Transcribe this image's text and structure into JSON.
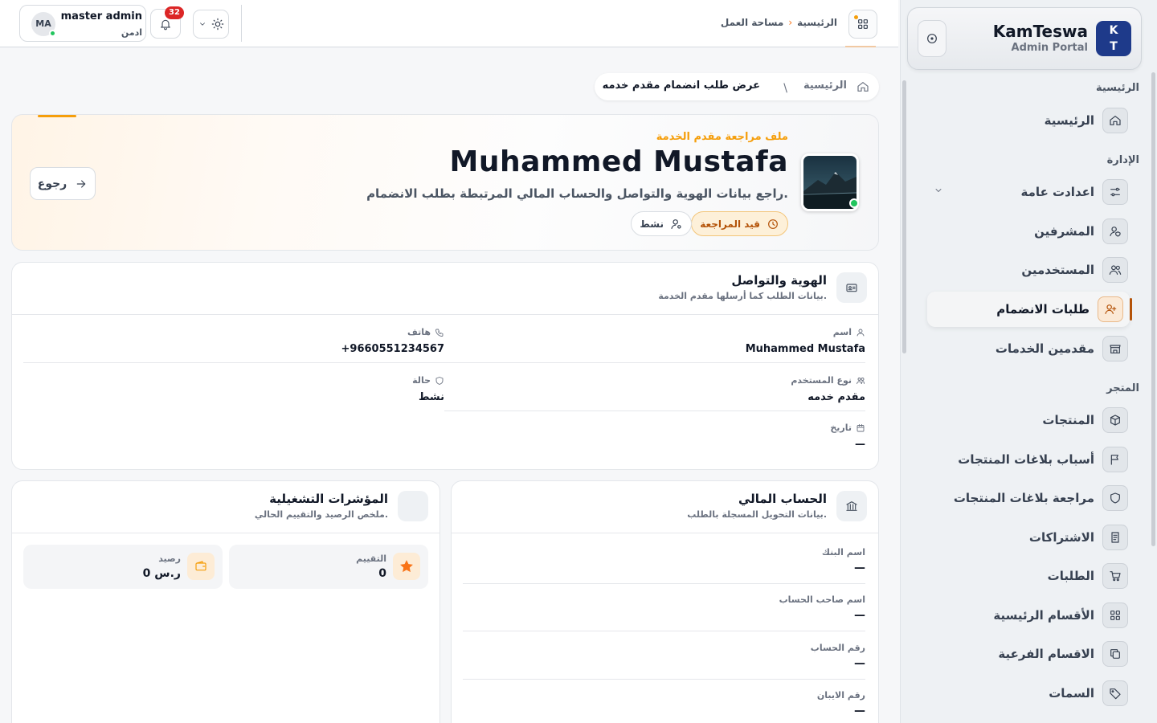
{
  "topbar": {
    "breadcrumb_root": "الرئيسية",
    "breadcrumb_current": "مساحة العمل",
    "notifications_count": "32",
    "user_initials": "MA",
    "user_name": "master admin",
    "user_role": "ادمن"
  },
  "sidebar": {
    "brand_logo_line1": "K",
    "brand_logo_line2": "T",
    "brand_name": "KamTeswa",
    "brand_sub": "Admin Portal",
    "sections": {
      "home": "الرئيسية",
      "admin": "الإدارة",
      "store": "المتجر"
    },
    "items": [
      {
        "label": "الرئيسية",
        "icon": "home-icon"
      },
      {
        "label": "اعدادت عامة",
        "icon": "sliders-icon"
      },
      {
        "label": "المشرفين",
        "icon": "user-shield-icon"
      },
      {
        "label": "المستخدمين",
        "icon": "users-icon"
      },
      {
        "label": "طلبات الانضمام",
        "icon": "user-plus-icon"
      },
      {
        "label": "مقدمين الخدمات",
        "icon": "store-icon"
      },
      {
        "label": "المنتجات",
        "icon": "box-icon"
      },
      {
        "label": "أسباب بلاغات المنتجات",
        "icon": "flag-icon"
      },
      {
        "label": "مراجعة بلاغات المنتجات",
        "icon": "shield-icon"
      },
      {
        "label": "الاشتراكات",
        "icon": "receipt-icon"
      },
      {
        "label": "الطلبات",
        "icon": "cart-icon"
      },
      {
        "label": "الأقسام الرئيسية",
        "icon": "grid-icon"
      },
      {
        "label": "الاقسام الفرعية",
        "icon": "copy-icon"
      },
      {
        "label": "السمات",
        "icon": "tag-icon"
      }
    ]
  },
  "page_breadcrumb": {
    "root": "الرئيسية",
    "separator": "\\",
    "current": "عرض طلب انضمام مقدم خدمه"
  },
  "hero": {
    "eyebrow": "ملف مراجعة مقدم الخدمة",
    "name": "Muhammed Mustafa",
    "description": "راجع بيانات الهوية والتواصل والحساب المالي المرتبطة بطلب الانضمام.",
    "status_review": "قيد المراجعة",
    "status_active": "نشط",
    "back_label": "رجوع"
  },
  "identity": {
    "title": "الهوية والتواصل",
    "subtitle": "بيانات الطلب كما أرسلها مقدم الخدمة.",
    "fields": {
      "name_label": "اسم",
      "name_value": "Muhammed Mustafa",
      "phone_label": "هاتف",
      "phone_value": "+9660551234567",
      "type_label": "نوع المستخدم",
      "type_value": "مقدم خدمه",
      "status_label": "حالة",
      "status_value": "نشط",
      "date_label": "تاريخ",
      "date_value": "—"
    }
  },
  "finance": {
    "title": "الحساب المالي",
    "subtitle": "بيانات التحويل المسجلة بالطلب.",
    "fields": [
      {
        "label": "اسم البنك",
        "value": "—"
      },
      {
        "label": "اسم صاحب الحساب",
        "value": "—"
      },
      {
        "label": "رقم الحساب",
        "value": "—"
      },
      {
        "label": "رقم الايبان",
        "value": "—"
      }
    ]
  },
  "metrics": {
    "title": "المؤشرات التشغيلية",
    "subtitle": "ملخص الرصيد والتقييم الحالي.",
    "rating_label": "التقييم",
    "rating_value": "0",
    "balance_label": "رصيد",
    "balance_value": "0 ر.س"
  },
  "colors": {
    "accent": "#f59e0b",
    "active_nav": "#b45309",
    "badge_red": "#dc2626",
    "online": "#22c55e"
  }
}
